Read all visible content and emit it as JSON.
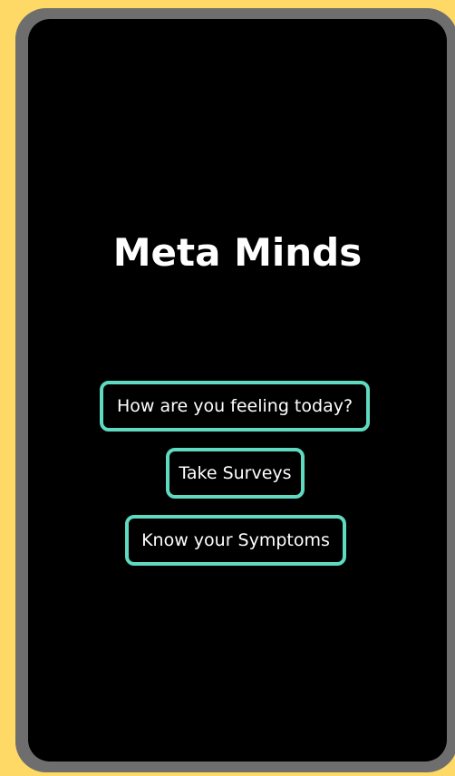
{
  "app": {
    "title": "Meta Minds"
  },
  "menu": {
    "feeling_label": "How are you feeling today?",
    "surveys_label": "Take Surveys",
    "symptoms_label": "Know your Symptoms"
  },
  "colors": {
    "background": "#ffd966",
    "bezel": "#6e6e6e",
    "screen": "#000000",
    "accent": "#5fd9bf",
    "text": "#ffffff"
  }
}
